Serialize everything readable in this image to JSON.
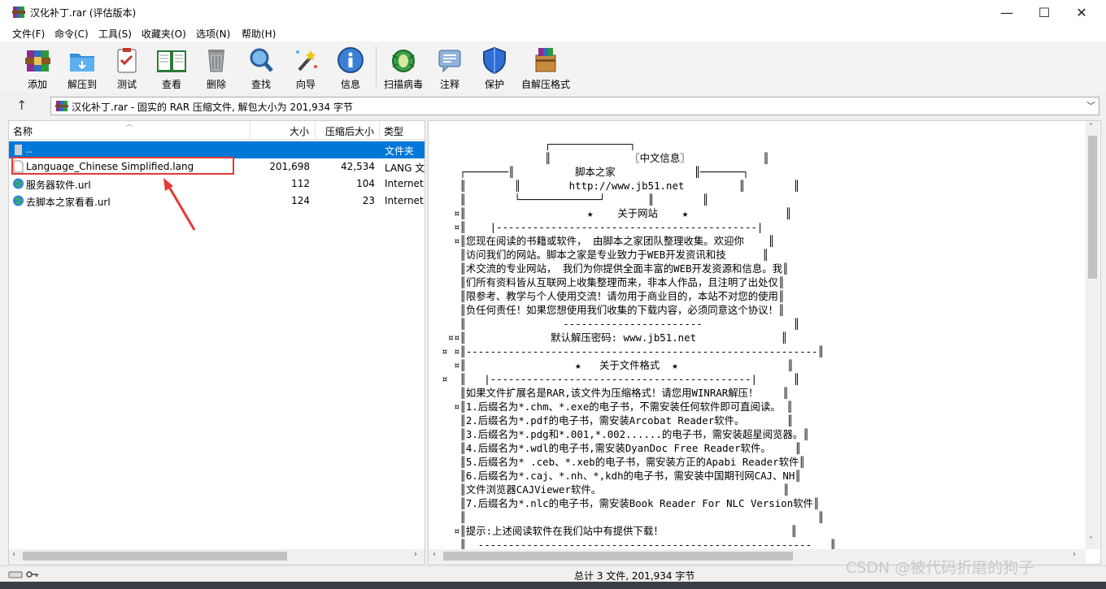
{
  "window": {
    "title": "汉化补丁.rar (评估版本)",
    "minimize": "—",
    "maximize": "☐",
    "close": "✕"
  },
  "menu": [
    "文件(F)",
    "命令(C)",
    "工具(S)",
    "收藏夹(O)",
    "选项(N)",
    "帮助(H)"
  ],
  "toolbar": [
    {
      "label": "添加",
      "icon": "add-archive-icon"
    },
    {
      "label": "解压到",
      "icon": "extract-to-icon"
    },
    {
      "label": "测试",
      "icon": "test-icon"
    },
    {
      "label": "查看",
      "icon": "view-icon"
    },
    {
      "label": "删除",
      "icon": "delete-icon"
    },
    {
      "label": "查找",
      "icon": "find-icon"
    },
    {
      "label": "向导",
      "icon": "wizard-icon"
    },
    {
      "label": "信息",
      "icon": "info-icon"
    },
    {
      "label": "扫描病毒",
      "icon": "virus-scan-icon"
    },
    {
      "label": "注释",
      "icon": "comment-icon"
    },
    {
      "label": "保护",
      "icon": "protect-icon"
    },
    {
      "label": "自解压格式",
      "icon": "sfx-icon"
    }
  ],
  "address": {
    "text": "汉化补丁.rar - 固实的 RAR 压缩文件, 解包大小为 201,934 字节"
  },
  "columns": {
    "name": "名称",
    "size": "大小",
    "packed": "压缩后大小",
    "type": "类型"
  },
  "files": [
    {
      "name": "..",
      "size": "",
      "packed": "",
      "type": "文件夹",
      "icon": "folder-up-icon",
      "selected": true
    },
    {
      "name": "Language_Chinese Simplified.lang",
      "size": "201,698",
      "packed": "42,534",
      "type": "LANG 文",
      "icon": "file-icon"
    },
    {
      "name": "服务器软件.url",
      "size": "112",
      "packed": "104",
      "type": "Internet",
      "icon": "internet-shortcut-icon"
    },
    {
      "name": "去脚本之家看看.url",
      "size": "124",
      "packed": "23",
      "type": "Internet",
      "icon": "internet-shortcut-icon"
    }
  ],
  "comment": {
    "lines": [
      "                 ┌─────────────┐",
      "                 ║             〖中文信息〗            ║",
      "   ┌───────║          脚本之家             ║───────┐",
      "   ║        ║        http://www.jb51.net         ║        ║",
      "   ║        └─────────────┘       ║        ║",
      "  ¤║                    ★    关于网站    ★                ║",
      "  ¤║    |-------------------------------------------|",
      "  ¤║您现在阅读的书籍或软件， 由脚本之家团队整理收集。欢迎你    ║",
      "   ║访问我们的网站。脚本之家是专业致力于WEB开发资讯和技      ║",
      "   ║术交流的专业网站， 我们为你提供全面丰富的WEB开发资源和信息。我║",
      "   ║们所有资料皆从互联网上收集整理而来，非本人作品，且注明了出处仅║",
      "   ║限参考、教学与个人使用交流！请勿用于商业目的，本站不对您的使用║",
      "   ║负任何责任！如果您想使用我们收集的下载内容，必须同意这个协议！║",
      "   ║                -----------------------               ║",
      " ¤¤║              默认解压密码: www.jb51.net              ║",
      "¤ ¤║----------------------------------------------------------║",
      "  ¤║                  ★   关于文件格式  ★                  ║",
      "¤  ║   |-------------------------------------------|      ║",
      "   ║如果文件扩展名是RAR,该文件为压缩格式！请您用WINRAR解压！    ║",
      "  ¤║1.后缀名为*.chm、*.exe的电子书，不需安装任何软件即可直阅读。 ║",
      "   ║2.后缀名为*.pdf的电子书，需安装Arcobat Reader软件。       ║",
      "   ║3.后缀名为*.pdg和*.001,*.002......的电子书，需安装超星阅览器。║",
      "   ║4.后缀名为*.wdl的电子书,需安装DyanDoc Free Reader软件。    ║",
      "   ║5.后缀名为* .ceb、*.xeb的电子书，需安装方正的Apabi Reader软件║",
      "   ║6.后缀名为*.caj、*.nh、*,kdh的电子书，需安装中国期刊网CAJ、NH║",
      "   ║文件浏览器CAJViewer软件。                              ║",
      "   ║7.后缀名为*.nlc的电子书，需安装Book Reader For NLC Version软件║",
      "   ║                                                          ║",
      "  ¤║提示:上述阅读软件在我们站中有提供下载！                     ║",
      "   ║  -------------------------------------------------------   ║"
    ]
  },
  "status": {
    "summary": "总计 3 文件, 201,934 字节"
  },
  "watermark": "CSDN @被代码折磨的狗子",
  "colors": {
    "selection": "#0078d7",
    "highlight_box": "#e53935"
  }
}
